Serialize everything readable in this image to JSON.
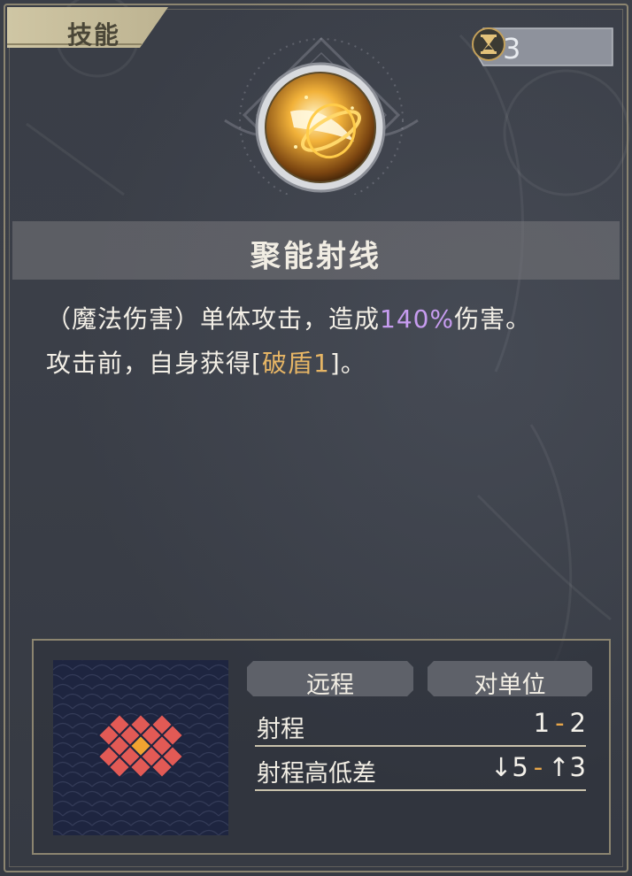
{
  "tab": {
    "label": "技能"
  },
  "cooldown": {
    "value": "3",
    "icon": "hourglass-icon"
  },
  "skill": {
    "icon": "energy-beam-icon",
    "name": "聚能射线",
    "description": {
      "line1_prefix": "（魔法伤害）单体攻击，造成",
      "line1_percent": "140%",
      "line1_suffix": "伤害。",
      "line2_prefix": "攻击前，自身获得[",
      "line2_keyword": "破盾1",
      "line2_suffix": "]。"
    }
  },
  "info": {
    "attack_type": "远程",
    "target_type": "对单位",
    "range": {
      "label": "射程",
      "min": "1",
      "max": "2"
    },
    "height_diff": {
      "label": "射程高低差",
      "down": "↓5",
      "up": "↑3"
    },
    "pattern": {
      "center": [
        4,
        2
      ],
      "cells": [
        [
          2,
          0
        ],
        [
          4,
          0
        ],
        [
          6,
          0
        ],
        [
          1,
          1
        ],
        [
          3,
          1
        ],
        [
          5,
          1
        ],
        [
          7,
          1
        ],
        [
          2,
          2
        ],
        [
          6,
          2
        ],
        [
          1,
          3
        ],
        [
          3,
          3
        ],
        [
          5,
          3
        ],
        [
          7,
          3
        ],
        [
          2,
          4
        ],
        [
          4,
          4
        ],
        [
          6,
          4
        ]
      ]
    }
  },
  "colors": {
    "accent_gold": "#e6b565",
    "percent_purple": "#c79cf0",
    "area_red": "#e25a55",
    "area_center": "#f0a330",
    "grid_bg": "#1e2540",
    "frame": "#8c8570"
  }
}
